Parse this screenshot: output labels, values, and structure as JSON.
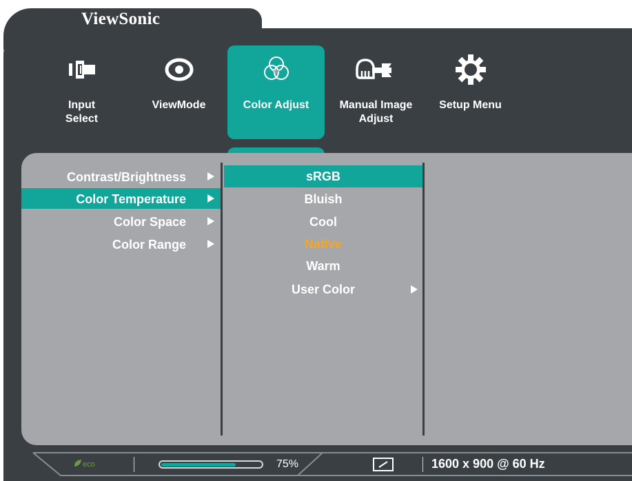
{
  "brand": "ViewSonic",
  "colors": {
    "accent": "#12a69b",
    "background": "#3a3f44",
    "panel": "#a5a7aa",
    "highlight": "#f5a623"
  },
  "nav": {
    "items": [
      {
        "label": "Input Select",
        "icon": "input-select-icon"
      },
      {
        "label": "ViewMode",
        "icon": "eye-icon"
      },
      {
        "label": "Color Adjust",
        "icon": "color-circles-icon",
        "active": true
      },
      {
        "label": "Manual Image Adjust",
        "icon": "hand-wrench-icon"
      },
      {
        "label": "Setup Menu",
        "icon": "gear-icon"
      }
    ]
  },
  "submenu": {
    "items": [
      {
        "label": "Contrast/Brightness"
      },
      {
        "label": "Color Temperature",
        "active": true
      },
      {
        "label": "Color Space"
      },
      {
        "label": "Color Range"
      }
    ]
  },
  "options": {
    "items": [
      {
        "label": "sRGB",
        "highlighted": true
      },
      {
        "label": "Bluish"
      },
      {
        "label": "Cool"
      },
      {
        "label": "Native",
        "current": true
      },
      {
        "label": "Warm"
      },
      {
        "label": "User Color",
        "has_submenu": true
      }
    ]
  },
  "status": {
    "eco_label": "eco",
    "progress_percent": 75,
    "progress_text": "75%",
    "aspect_icon": "aspect-ratio-icon",
    "resolution": "1600 x 900 @ 60 Hz"
  }
}
